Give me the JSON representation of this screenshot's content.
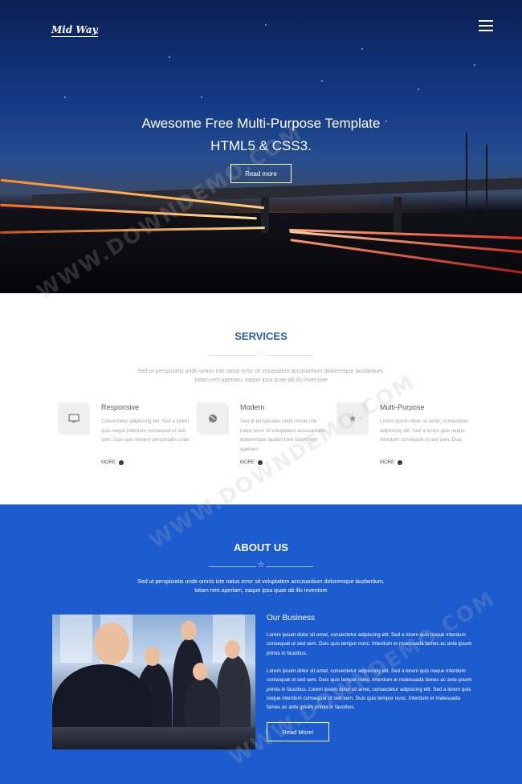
{
  "header": {
    "logo": "Mid Way",
    "menu_icon": "hamburger-menu-icon"
  },
  "hero": {
    "line1": "Awesome Free Multi-Purpose Template",
    "line2": "HTML5 & CSS3.",
    "button": "Read more"
  },
  "services": {
    "title": "SERVICES",
    "divider_icon": "star-icon",
    "subtitle_line1": "Sed ut perspiciatis unde omnis iste natus error sit voluptatem accusantium doloremque laudantium,",
    "subtitle_line2": "totam rem aperiam, eaque ipsa quae ab illo inventore",
    "items": [
      {
        "icon": "monitor-icon",
        "title": "Responsive",
        "desc": "Consectetur adipiscing elit. Sed a lorem quis neque interdum consequat ut sed sem. Duis quis tempor perspiciatis unde.",
        "more": "MORE"
      },
      {
        "icon": "globe-icon",
        "title": "Modern",
        "desc": "Sed ut perspiciatis unde omnis iste natus error sit voluptatem accusantium doloremque laudan tium totam rem aperiam.",
        "more": "MORE"
      },
      {
        "icon": "star-icon",
        "title": "Multi-Purpose",
        "desc": "Lorem ipsum dolor sit amet, consectetur adipiscing elit. Sed a lorem quis neque interdum consequat ut sed sem. Duis.",
        "more": "MORE"
      }
    ]
  },
  "about": {
    "title": "ABOUT US",
    "divider_icon": "star-icon",
    "subtitle_line1": "Sed ut perspiciatis unde omnis iste natus error sit voluptatem accusantium doloremque laudantium,",
    "subtitle_line2": "totam rem aperiam, eaque ipsa quae ab illo inventore",
    "business_title": "Our Business",
    "para1": "Lorem ipsum dolor sit amet, consectetur adipiscing elit. Sed a lorem quis neque interdum consequat ut sed sem. Duis quis tempor nunc. Interdum et malesuada fames ac ante ipsum primis in faucibus.",
    "para2": "Lorem ipsum dolor sit amet, consectetur adipiscing elit. Sed a lorem quis neque interdum consequat ut sed sem. Duis quis tempor nunc. Interdum et malesuada fames ac ante ipsum primis in faucibus. Lorem ipsum dolor sit amet, consectetur adipiscing elit. Sed a lorem quis neque interdum consequat ut sed sem. Duis quis tempor nunc. Interdum et malesuada fames ac ante ipsum primis in faucibus.",
    "button": "Read More!"
  },
  "watermark": "WWW.DOWNDEMO.COM"
}
